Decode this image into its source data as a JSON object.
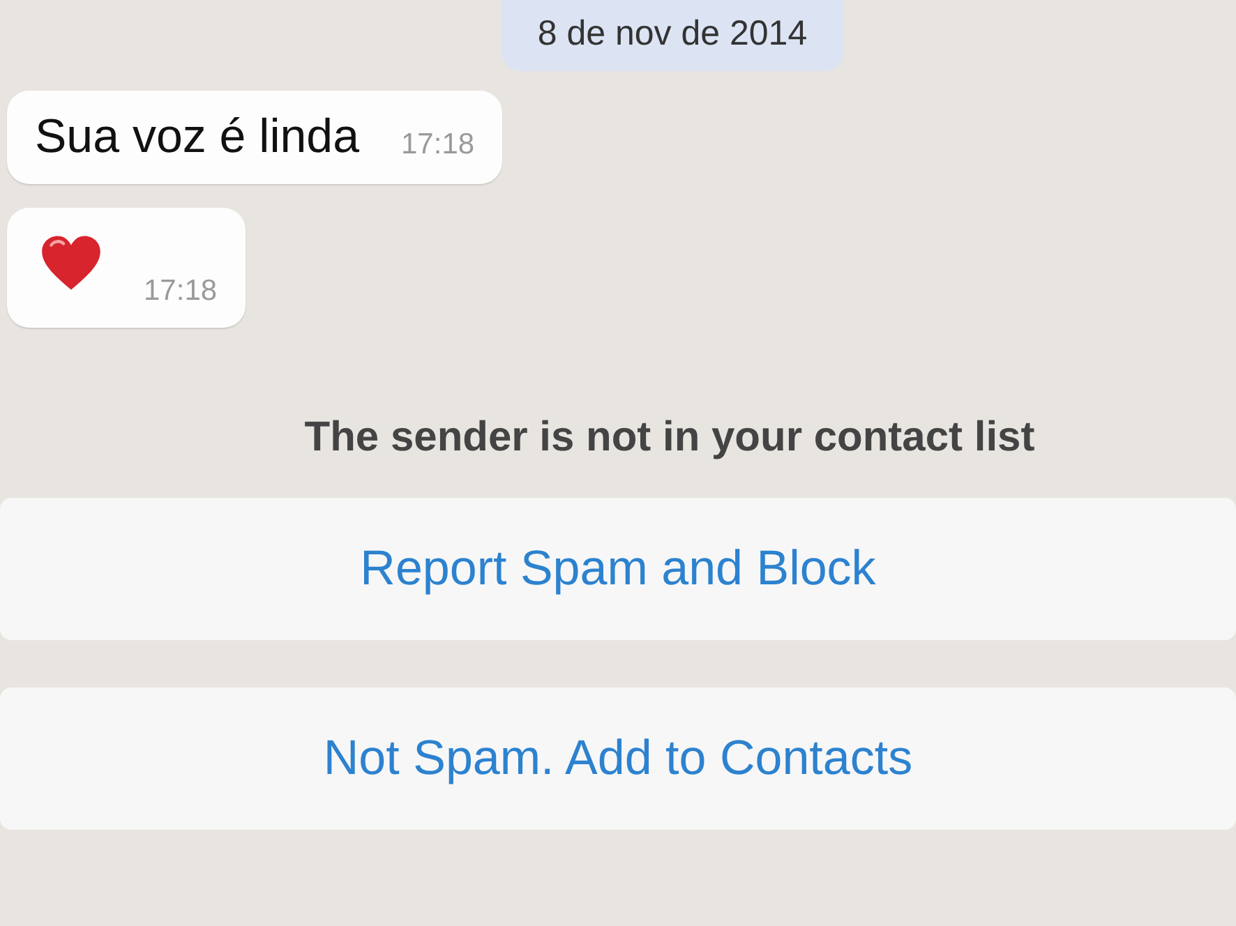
{
  "date_label": "8 de nov de 2014",
  "messages": [
    {
      "kind": "text",
      "text": "Sua voz é linda",
      "time": "17:18"
    },
    {
      "kind": "heart",
      "time": "17:18"
    }
  ],
  "notice": "The sender is not in your contact list",
  "buttons": [
    "Report Spam and Block",
    "Not Spam. Add to Contacts"
  ]
}
